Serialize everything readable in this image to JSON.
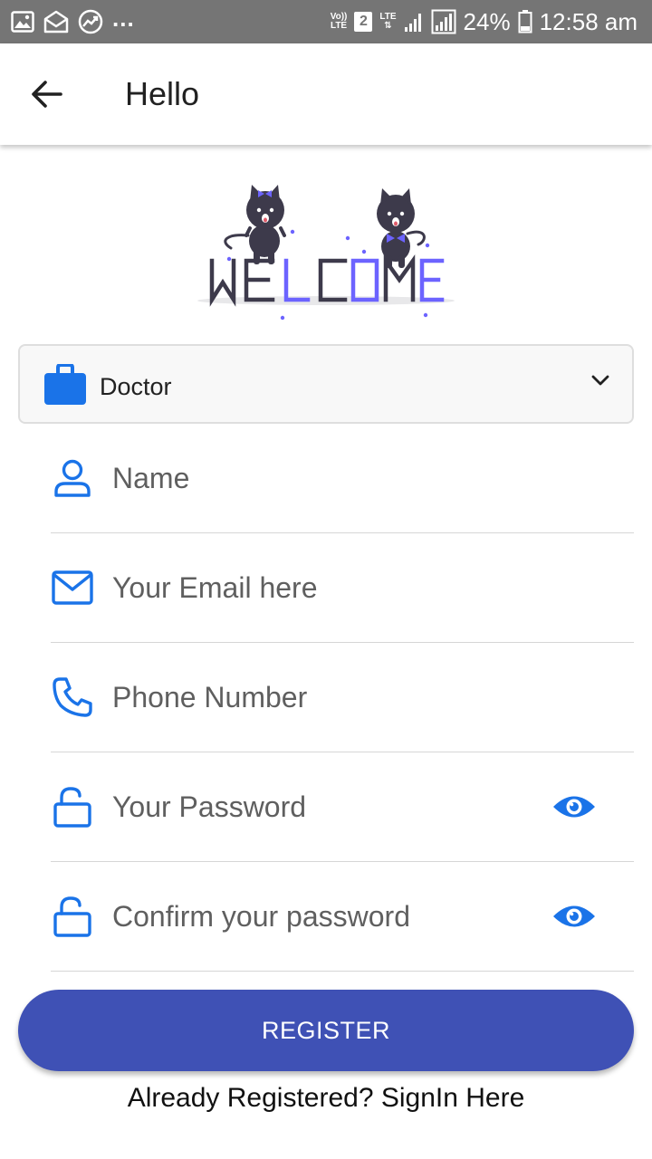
{
  "status_bar": {
    "notification_icons": [
      "image-icon",
      "mail-icon",
      "trending-icon"
    ],
    "more_indicator": "...",
    "volte_top": "Vo))",
    "volte_bottom": "LTE",
    "sim_slot": "2",
    "network_type": "LTE",
    "battery_percent": "24%",
    "time": "12:58 am"
  },
  "app_bar": {
    "title": "Hello",
    "back_icon": "arrow-left-icon"
  },
  "welcome": {
    "text": "WELCOME",
    "colors": {
      "dark": "#3d3a4b",
      "accent": "#6c63ff"
    }
  },
  "role_select": {
    "icon": "briefcase-icon",
    "selected": "Doctor"
  },
  "form": {
    "name": {
      "icon": "person-icon",
      "placeholder": "Name",
      "value": ""
    },
    "email": {
      "icon": "mail-icon",
      "placeholder": "Your Email here",
      "value": ""
    },
    "phone": {
      "icon": "phone-icon",
      "placeholder": "Phone Number",
      "value": ""
    },
    "password": {
      "icon": "lock-open-icon",
      "placeholder": "Your Password",
      "value": "",
      "toggle_icon": "eye-icon"
    },
    "confirm_password": {
      "icon": "lock-open-icon",
      "placeholder": "Confirm your password",
      "value": "",
      "toggle_icon": "eye-icon"
    }
  },
  "actions": {
    "register_label": "REGISTER",
    "signin_prompt": "Already Registered? SignIn Here"
  },
  "colors": {
    "primary": "#3f51b5",
    "icon_blue": "#1a73e8",
    "status_bar": "#757575"
  }
}
